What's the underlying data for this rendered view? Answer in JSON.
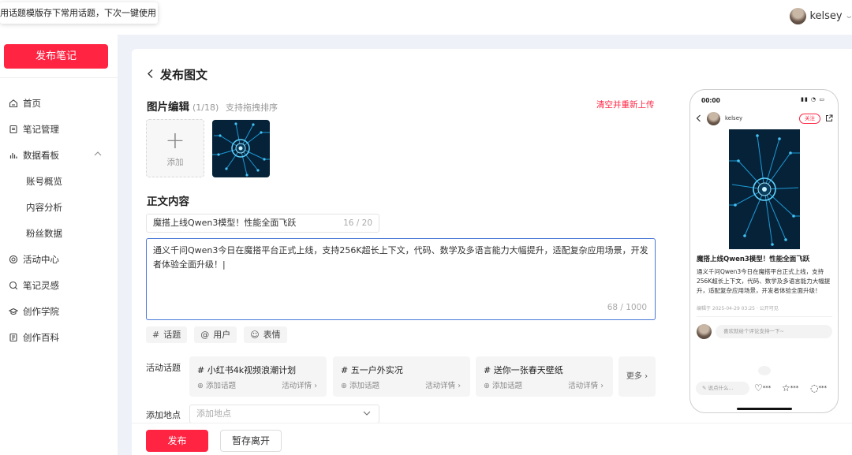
{
  "tooltip": "用话题模版存下常用话题，下次一键使用",
  "user": {
    "name": "kelsey"
  },
  "sidebar": {
    "publish_button": "发布笔记",
    "items": [
      {
        "label": "首页",
        "icon": "home-icon"
      },
      {
        "label": "笔记管理",
        "icon": "note-icon"
      },
      {
        "label": "数据看板",
        "icon": "chart-icon",
        "expanded": true
      },
      {
        "label": "账号概览"
      },
      {
        "label": "内容分析"
      },
      {
        "label": "粉丝数据"
      },
      {
        "label": "活动中心",
        "icon": "activity-icon"
      },
      {
        "label": "笔记灵感",
        "icon": "idea-icon"
      },
      {
        "label": "创作学院",
        "icon": "academy-icon"
      },
      {
        "label": "创作百科",
        "icon": "wiki-icon"
      }
    ]
  },
  "page": {
    "title": "发布图文",
    "image_section": {
      "title": "图片编辑",
      "count": "(1/18)",
      "hint": "支持拖拽排序",
      "clear_link": "清空并重新上传",
      "add_label": "添加"
    },
    "body_section": {
      "title": "正文内容",
      "title_value": "魔搭上线Qwen3模型！性能全面飞跃",
      "title_count": "16 / 20",
      "body_value": "通义千问Qwen3今日在魔搭平台正式上线，支持256K超长上下文，代码、数学及多语言能力大幅提升，适配复杂应用场景，开发者体验全面升级！",
      "body_count": "68 / 1000"
    },
    "tools": [
      {
        "icon": "#",
        "label": "话题"
      },
      {
        "icon": "@",
        "label": "用户"
      },
      {
        "icon": "☺",
        "label": "表情"
      }
    ],
    "activity_label": "活动话题",
    "topics": [
      {
        "name": "# 小红书4k视频浪潮计划",
        "add": "添加话题",
        "detail": "活动详情 ›"
      },
      {
        "name": "# 五一户外实况",
        "add": "添加话题",
        "detail": "活动详情 ›"
      },
      {
        "name": "# 送你一张春天壁纸",
        "add": "添加话题",
        "detail": "活动详情 ›"
      }
    ],
    "more": "更多 ›",
    "location_label": "添加地点",
    "location_placeholder": "添加地点",
    "publish": "发布",
    "draft": "暂存离开"
  },
  "phone": {
    "time": "00:00",
    "username": "kelsey",
    "follow": "关注",
    "title": "魔搭上线Qwen3模型！性能全面飞跃",
    "body": "通义千问Qwen3今日在魔搭平台正式上线，支持256K超长上下文，代码、数学及多语言能力大幅提升，适配复杂应用场景，开发者体验全面升级！",
    "meta": "编辑于 2025-04-29 03:25 · 公开可见",
    "comment_placeholder": "喜欢就给个评论支持一下~",
    "say_placeholder": "说点什么...",
    "like": "***",
    "collect": "***",
    "comment": "***"
  },
  "colors": {
    "accent": "#ff2442",
    "focus": "#4a78d6",
    "bg": "#eef1f7"
  }
}
